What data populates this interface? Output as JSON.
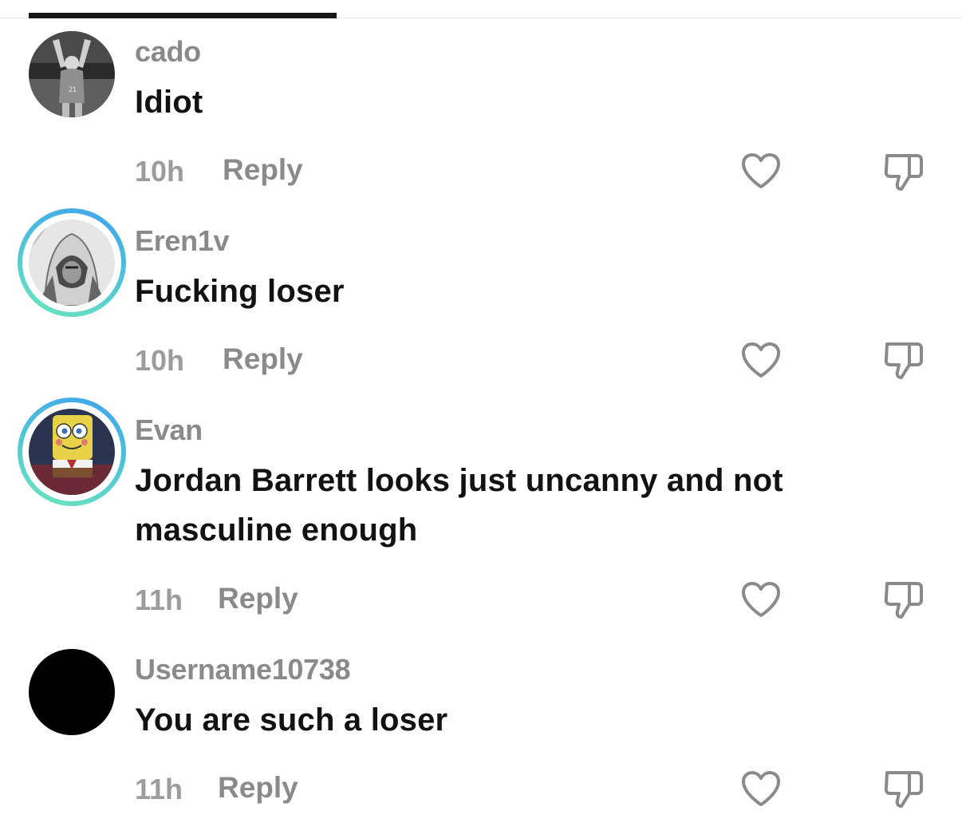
{
  "comments": [
    {
      "username": "cado",
      "text": "Idiot",
      "time": "10h",
      "reply_label": "Reply",
      "avatar_icon": "avatar-photo-footballer"
    },
    {
      "username": "Eren1v",
      "text": "Fucking loser",
      "time": "10h",
      "reply_label": "Reply",
      "avatar_icon": "avatar-photo-hooded-figure",
      "story_ring": true
    },
    {
      "username": "Evan",
      "text": "Jordan Barrett looks just uncanny and not masculine enough",
      "time": "11h",
      "reply_label": "Reply",
      "avatar_icon": "avatar-photo-spongebob",
      "story_ring": true
    },
    {
      "username": "Username10738",
      "text": "You are such a loser",
      "time": "11h",
      "reply_label": "Reply",
      "avatar_icon": "avatar-black-circle"
    }
  ],
  "colors": {
    "ring_start": "#3fa2ee",
    "ring_end": "#6fe7b9",
    "username": "#8a8a8a",
    "text": "#121212"
  }
}
